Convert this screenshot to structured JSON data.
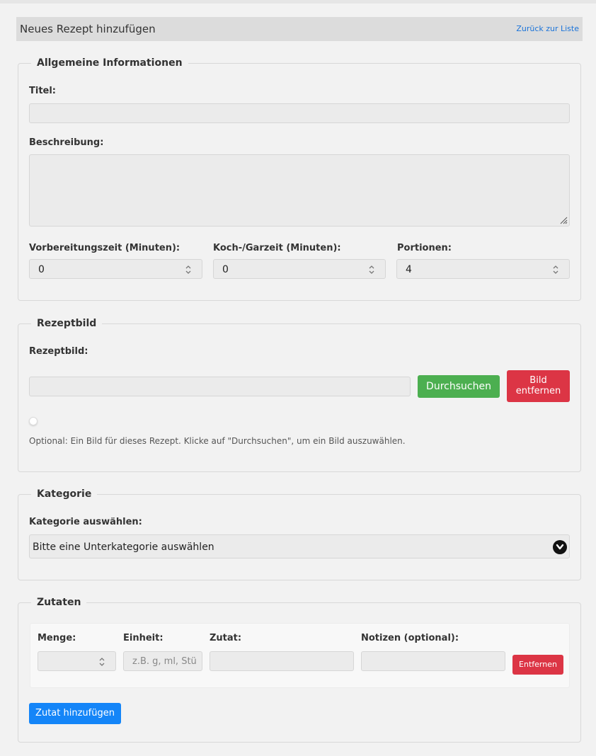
{
  "header": {
    "title": "Neues Rezept hinzufügen",
    "back_link": "Zurück zur Liste"
  },
  "general": {
    "legend": "Allgemeine Informationen",
    "title_label": "Titel:",
    "title_value": "",
    "description_label": "Beschreibung:",
    "description_value": "",
    "prep_label": "Vorbereitungszeit (Minuten):",
    "prep_value": "0",
    "cook_label": "Koch-/Garzeit (Minuten):",
    "cook_value": "0",
    "servings_label": "Portionen:",
    "servings_value": "4"
  },
  "image": {
    "legend": "Rezeptbild",
    "label": "Rezeptbild:",
    "path_value": "",
    "browse_label": "Durchsuchen",
    "remove_label_line1": "Bild",
    "remove_label_line2": "entfernen",
    "hint": "Optional: Ein Bild für dieses Rezept. Klicke auf \"Durchsuchen\", um ein Bild auszuwählen."
  },
  "category": {
    "legend": "Kategorie",
    "label": "Kategorie auswählen:",
    "selected": "Bitte eine Unterkategorie auswählen"
  },
  "ingredients": {
    "legend": "Zutaten",
    "headers": {
      "amount": "Menge:",
      "unit": "Einheit:",
      "ingredient": "Zutat:",
      "notes": "Notizen (optional):"
    },
    "row": {
      "amount": "",
      "unit_placeholder": "z.B. g, ml, Stü",
      "ingredient": "",
      "notes": "",
      "remove_label": "Entfernen"
    },
    "add_label": "Zutat hinzufügen"
  },
  "colors": {
    "accent_blue": "#1485f8",
    "browse_green": "#4caf50",
    "danger_red": "#dc3545",
    "link_blue": "#1a73d9"
  }
}
